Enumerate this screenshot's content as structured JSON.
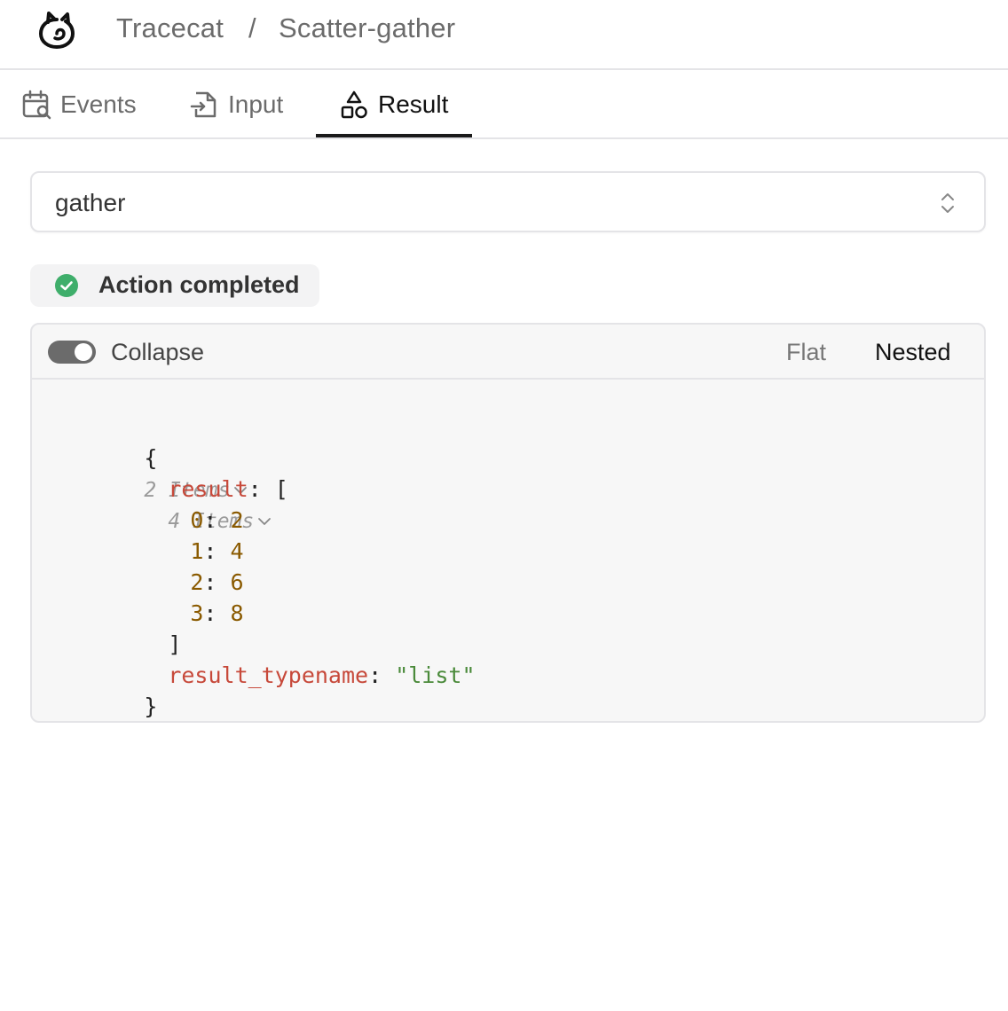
{
  "header": {
    "app_name": "Tracecat",
    "separator": "/",
    "page_title": "Scatter-gather"
  },
  "tabs": [
    {
      "label": "Events",
      "icon": "calendar-search-icon",
      "active": false
    },
    {
      "label": "Input",
      "icon": "file-input-icon",
      "active": false
    },
    {
      "label": "Result",
      "icon": "shapes-icon",
      "active": true
    }
  ],
  "action_select": {
    "value": "gather",
    "icon": "chevrons-up-down-icon"
  },
  "status": {
    "label": "Action completed",
    "icon": "check-circle-icon",
    "color": "#3fae6b"
  },
  "viewer": {
    "collapse_label": "Collapse",
    "collapse_on": true,
    "flat_label": "Flat",
    "nested_label": "Nested",
    "selected_mode": "Nested"
  },
  "json_tree": {
    "root_open": "{",
    "root_meta": "2 Items",
    "result_key": "result",
    "result_open": "[",
    "result_meta": "4 Items",
    "items": [
      {
        "index": "0",
        "value": "2"
      },
      {
        "index": "1",
        "value": "4"
      },
      {
        "index": "2",
        "value": "6"
      },
      {
        "index": "3",
        "value": "8"
      }
    ],
    "result_close": "]",
    "typename_key": "result_typename",
    "typename_value": "\"list\"",
    "root_close": "}"
  }
}
